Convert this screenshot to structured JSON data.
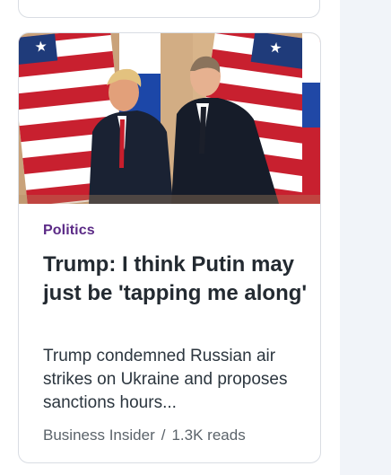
{
  "article": {
    "category": "Politics",
    "headline": "Trump: I think Putin may just be 'tapping me along'",
    "summary": "Trump condemned Russian air strikes on Ukraine and proposes sanctions hours...",
    "source": "Business Insider",
    "separator": "/",
    "reads": "1.3K reads"
  },
  "colors": {
    "category": "#5b2a86",
    "headline": "#232a31",
    "meta": "#5b636a",
    "rail": "#f1f4f9"
  }
}
